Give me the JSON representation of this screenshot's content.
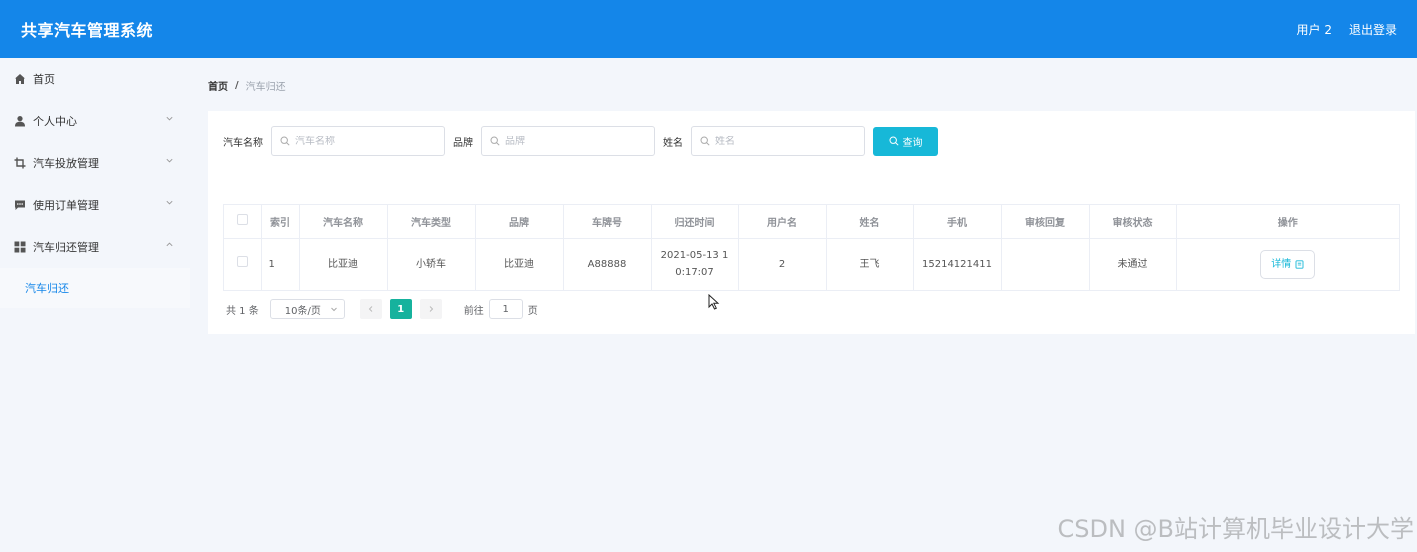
{
  "header": {
    "title": "共享汽车管理系统",
    "user": "用户 2",
    "logout": "退出登录",
    "bg_color": "#1486e9"
  },
  "sidebar": {
    "items": [
      {
        "label": "首页",
        "icon": "home-icon"
      },
      {
        "label": "个人中心",
        "icon": "user-icon",
        "expand": "chevron-down-icon"
      },
      {
        "label": "汽车投放管理",
        "icon": "crop-icon",
        "expand": "chevron-down-icon"
      },
      {
        "label": "使用订单管理",
        "icon": "chat-icon",
        "expand": "chevron-down-icon"
      },
      {
        "label": "汽车归还管理",
        "icon": "grid-icon",
        "expand": "chevron-up-icon"
      }
    ],
    "submenu": {
      "label": "汽车归还",
      "active": true
    }
  },
  "breadcrumb": {
    "home": "首页",
    "separator": "/",
    "current": "汽车归还"
  },
  "search": {
    "car_name_label": "汽车名称",
    "car_name_placeholder": "汽车名称",
    "brand_label": "品牌",
    "brand_placeholder": "品牌",
    "name_label": "姓名",
    "name_placeholder": "姓名",
    "query_label": "查询",
    "query_color": "#17b8d8"
  },
  "table": {
    "headers": [
      "索引",
      "汽车名称",
      "汽车类型",
      "品牌",
      "车牌号",
      "归还时间",
      "用户名",
      "姓名",
      "手机",
      "审核回复",
      "审核状态",
      "操作"
    ],
    "rows": [
      {
        "index": "1",
        "car_name": "比亚迪",
        "car_type": "小轿车",
        "brand": "比亚迪",
        "plate": "A88888",
        "return_time": "2021-05-13 1\n0:17:07",
        "return_time_line1": "2021-05-13 1",
        "return_time_line2": "0:17:07",
        "username": "2",
        "name": "王飞",
        "phone": "15214121411",
        "reply": "",
        "status": "未通过",
        "action": "详情"
      }
    ]
  },
  "pagination": {
    "total": "共 1 条",
    "page_size": "10条/页",
    "current_page": "1",
    "goto_label": "前往",
    "goto_value": "1",
    "page_suffix": "页",
    "active_color": "#16b29d"
  },
  "watermark": "CSDN @B站计算机毕业设计大学"
}
